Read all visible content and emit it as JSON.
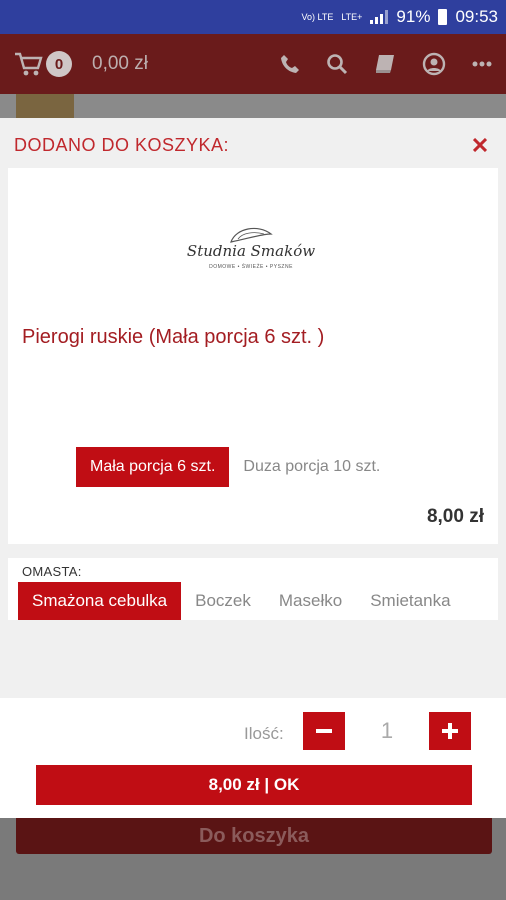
{
  "status_bar": {
    "volte": "Vo) LTE",
    "lte": "LTE+",
    "battery": "91%",
    "time": "09:53"
  },
  "app_bar": {
    "cart_count": "0",
    "cart_total": "0,00 zł",
    "icons": [
      "cart-icon",
      "phone-icon",
      "search-icon",
      "book-icon",
      "account-icon",
      "more-icon"
    ]
  },
  "modal": {
    "title": "DODANO DO KOSZYKA:",
    "logo": {
      "name": "Studnia Smaków",
      "tagline": "DOMOWE • ŚWIEŻE • PYSZNE"
    },
    "product_name": "Pierogi ruskie (Mała porcja 6 szt. )",
    "variants": [
      {
        "label": "Mała porcja 6 szt.",
        "selected": true
      },
      {
        "label": "Duza porcja 10 szt.",
        "selected": false
      }
    ],
    "price": "8,00 zł",
    "omasta": {
      "label": "OMASTA:",
      "options": [
        {
          "label": "Smażona cebulka",
          "selected": true
        },
        {
          "label": "Boczek",
          "selected": false
        },
        {
          "label": "Masełko",
          "selected": false
        },
        {
          "label": "Smietanka",
          "selected": false
        }
      ]
    },
    "quantity": {
      "label": "Ilość:",
      "value": "1"
    },
    "ok_button": "8,00 zł | OK"
  },
  "background": {
    "add_to_cart_button": "Do koszyka"
  },
  "colors": {
    "accent": "#c00d14",
    "title_red": "#c0282d",
    "status_bar": "#2f3f9e"
  }
}
